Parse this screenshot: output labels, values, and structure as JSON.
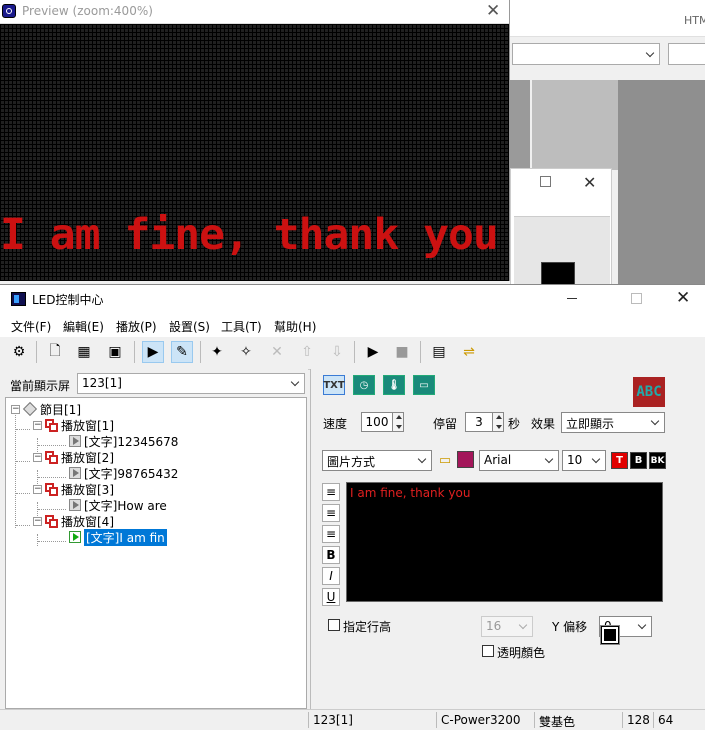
{
  "background_app": {
    "html_label": "HTM"
  },
  "preview": {
    "title": "Preview (zoom:400%)",
    "close": "✕",
    "led_text": "I am fine, thank you",
    "colors": {
      "led_text": "#cc1111",
      "led_bg": "#202020"
    }
  },
  "window": {
    "title": "LED控制中心",
    "close": "✕",
    "menu": [
      "文件(F)",
      "編輯(E)",
      "播放(P)",
      "設置(S)",
      "工具(T)",
      "幫助(H)"
    ]
  },
  "left": {
    "screen_label": "當前顯示屏",
    "screen_value": "123[1]",
    "tree": {
      "root": "節目[1]",
      "windows": [
        {
          "label": "播放窗[1]",
          "child": "[文字]12345678"
        },
        {
          "label": "播放窗[2]",
          "child": "[文字]98765432"
        },
        {
          "label": "播放窗[3]",
          "child": "[文字]How are"
        },
        {
          "label": "播放窗[4]",
          "child": "[文字]I am fin"
        }
      ]
    }
  },
  "right": {
    "tool_txt": "TXT",
    "abc_icon": "ABC",
    "speed_label": "速度",
    "speed_value": "100",
    "stay_label": "停留",
    "stay_value": "3",
    "stay_unit": "秒",
    "effect_label": "效果",
    "effect_value": "立即顯示",
    "mode_value": "圖片方式",
    "font_value": "Arial",
    "size_value": "10",
    "color_t": "T",
    "color_b": "B",
    "color_bk": "BK",
    "fmt_bold": "B",
    "fmt_italic": "I",
    "fmt_underline": "U",
    "editor_text": "I am fine, thank you",
    "line_label": "指定行高",
    "line_value": "16",
    "yoffset_label": "Y 偏移",
    "yoffset_value": "0",
    "transparent_label": "透明顏色",
    "colors": {
      "editor_text": "#e02020",
      "t_btn": "#e00000"
    }
  },
  "status": {
    "screen": "123[1]",
    "controller": "C-Power3200",
    "color_mode": "雙基色",
    "width": "128",
    "height": "64"
  }
}
